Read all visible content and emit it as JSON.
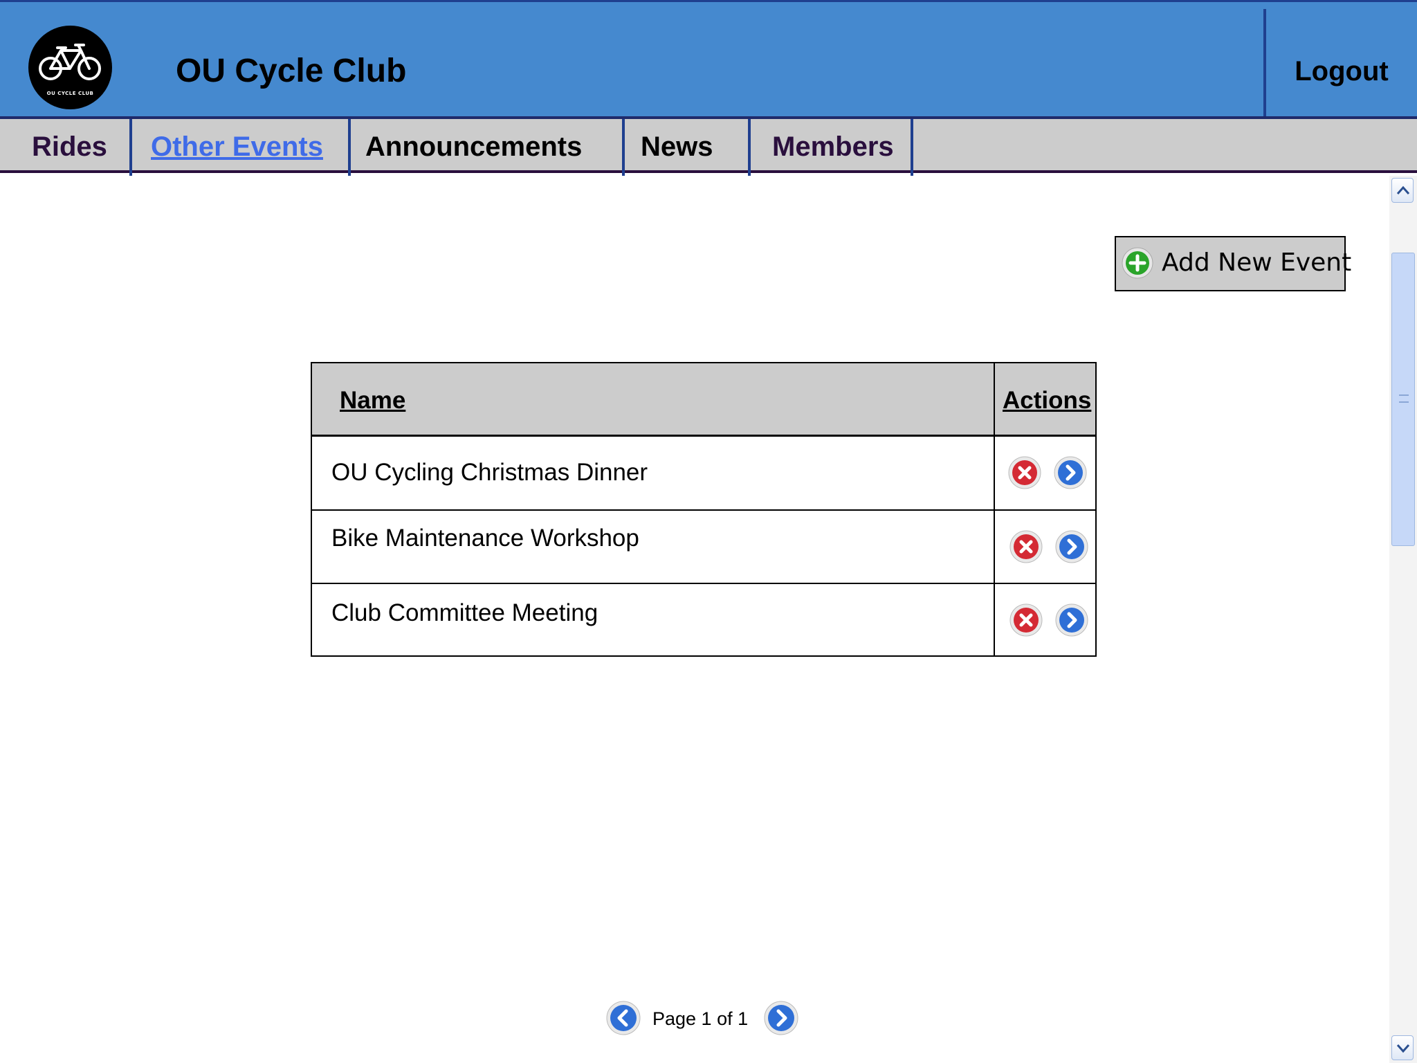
{
  "header": {
    "logo_text": "OU CYCLE CLUB",
    "title": "OU Cycle Club",
    "logout_label": "Logout"
  },
  "nav": {
    "tabs": [
      {
        "label": "Rides",
        "active": false
      },
      {
        "label": "Other Events",
        "active": true
      },
      {
        "label": "Announcements",
        "active": false
      },
      {
        "label": "News",
        "active": false
      },
      {
        "label": "Members",
        "active": false
      }
    ]
  },
  "toolbar": {
    "add_label": "Add New Event"
  },
  "table": {
    "columns": [
      "Name",
      "Actions"
    ],
    "rows": [
      {
        "name": "OU Cycling Christmas Dinner"
      },
      {
        "name": "Bike Maintenance Workshop"
      },
      {
        "name": "Club Committee Meeting"
      }
    ]
  },
  "pager": {
    "text": "Page 1 of 1"
  },
  "icons": {
    "logo": "bicycle-icon",
    "add": "plus-circle-icon",
    "delete": "close-circle-icon",
    "open": "chevron-right-circle-icon",
    "prev": "chevron-left-circle-icon",
    "next": "chevron-right-circle-icon"
  },
  "colors": {
    "header_bg": "#4589cf",
    "nav_bg": "#cccccc",
    "active_tab": "#3f6be8",
    "add_icon": "#2aa42a",
    "delete_icon": "#d42a34",
    "open_icon": "#2f6fd6"
  }
}
